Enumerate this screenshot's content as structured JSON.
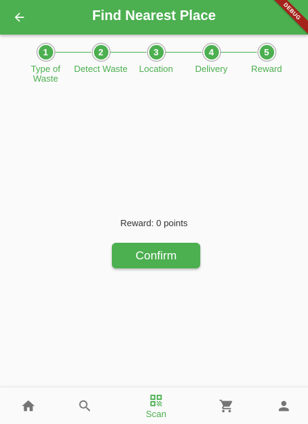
{
  "appbar": {
    "title": "Find Nearest Place",
    "debug_label": "DEBUG",
    "color": "#4caf50"
  },
  "stepper": {
    "steps": [
      {
        "number": "1",
        "label": "Type of Waste"
      },
      {
        "number": "2",
        "label": "Detect Waste"
      },
      {
        "number": "3",
        "label": "Location"
      },
      {
        "number": "4",
        "label": "Delivery"
      },
      {
        "number": "5",
        "label": "Reward"
      }
    ]
  },
  "main": {
    "reward_text": "Reward: 0 points",
    "confirm_label": "Confirm"
  },
  "bottom_nav": {
    "items": [
      {
        "icon": "home-icon",
        "label": ""
      },
      {
        "icon": "search-icon",
        "label": ""
      },
      {
        "icon": "qr-code-icon",
        "label": "Scan",
        "active": true
      },
      {
        "icon": "cart-icon",
        "label": ""
      },
      {
        "icon": "person-icon",
        "label": ""
      }
    ],
    "active_color": "#4caf50",
    "inactive_color": "#757575"
  }
}
